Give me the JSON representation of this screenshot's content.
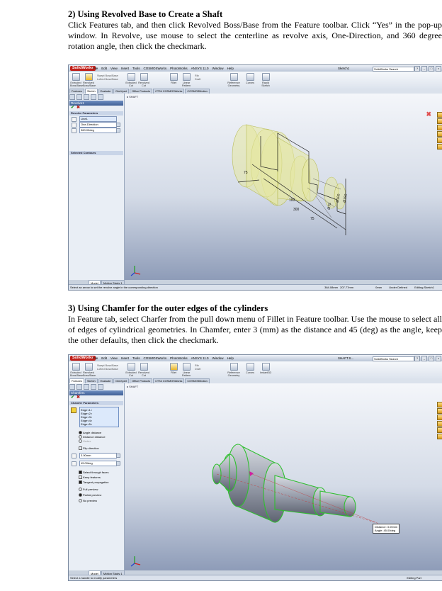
{
  "section2": {
    "heading": "2) Using Revolved Base to Create a Shaft",
    "body": "Click Features tab, and then click Revolved Boss/Base from the Feature toolbar. Click “Yes” in the pop-up window. In Revolve, use mouse to select the centerline as revolve axis, One-Direction, and 360 degree rotation angle, then click the checkmark."
  },
  "section3": {
    "heading": "3) Using Chamfer for the outer edges of the cylinders",
    "body": "In Feature tab, select Charfer from the pull down menu of Fillet in Feature toolbar. Use the mouse to select all of edges of cylindrical geometries. In Chamfer, enter 3 (mm) as the distance and 45 (deg) as the angle, keep the other defaults, then click the checkmark."
  },
  "app": {
    "logo": "SolidWorks",
    "menus": [
      "File",
      "Edit",
      "View",
      "Insert",
      "Tools",
      "COSMOSWorks",
      "PhotoWorks",
      "ANSYS 11.0",
      "Window",
      "Help"
    ],
    "search_placeholder": "SolidWorks Search",
    "window_buttons": [
      "?",
      "_",
      "□",
      "×"
    ]
  },
  "shot1": {
    "doc_title": "Sketch1",
    "ribbon": [
      "Extruded Boss/Base",
      "Revolved Boss/Base",
      "Swept Boss/Base",
      "Lofted Boss/Base",
      "Extruded Cut",
      "Revolved Cut",
      "Fillet",
      "Linear Pattern",
      "Rib",
      "Draft",
      "Reference Geometry",
      "Curves",
      "Rapid Sketch"
    ],
    "tabs": [
      "Features",
      "Sketch",
      "Evaluate",
      "DimXpert",
      "Office Products",
      "CTS4 COSMOSWorks",
      "COSMOSMotion"
    ],
    "active_tab": "Sketch",
    "pm_title": "Revolve1",
    "group1": "Revolve Parameters",
    "axis": "Line1",
    "direction": "One-Direction",
    "angle": "360.00deg",
    "group2": "Selected Contours",
    "tree_item": "SHAFT",
    "dims": [
      "75",
      "100",
      "300",
      "75",
      "Ø75",
      "Ø100",
      "Ø150"
    ],
    "bottom_tabs": [
      "Model",
      "Motion Study 1"
    ],
    "status": [
      "Select an arrow to set the revolve angle in the corresponding direction",
      "364.08mm",
      "207.77mm",
      "0mm",
      "Under Defined",
      "Editing Sketch1"
    ]
  },
  "shot2": {
    "doc_title": "SHAFT.S...",
    "ribbon": [
      "Extruded Boss/Base",
      "Revolved Boss/Base",
      "Swept Boss/Base",
      "Lofted Boss/Base",
      "Extruded Cut",
      "Revolved Cut",
      "Fillet",
      "Linear Pattern",
      "Rib",
      "Draft",
      "Reference Geometry",
      "Curves",
      "Instant3D"
    ],
    "tabs": [
      "Features",
      "Sketch",
      "Evaluate",
      "DimXpert",
      "Office Products",
      "CTS4 COSMOSWorks",
      "COSMOSMotion"
    ],
    "active_tab": "Features",
    "pm_title": "Chamfer1",
    "group1": "Chamfer Parameters",
    "edges": [
      "Edge<1>",
      "Edge<2>",
      "Edge<3>",
      "Edge<4>",
      "Edge<5>"
    ],
    "options": [
      "Angle distance",
      "Distance distance",
      "Vertex",
      "Flip direction"
    ],
    "distance": "3.00mm",
    "angle": "45.00deg",
    "checks": [
      "Select through faces",
      "Keep features",
      "Tangent propagation"
    ],
    "previews": [
      "Full preview",
      "Partial preview",
      "No preview"
    ],
    "tree_item": "SHAFT",
    "callout_distance": "Distance: 3.00mm",
    "callout_angle": "Angle: 45.00deg",
    "bottom_tabs": [
      "Model",
      "Motion Study 1"
    ],
    "status": [
      "Select a handle to modify parameters",
      "Editing Part"
    ]
  }
}
